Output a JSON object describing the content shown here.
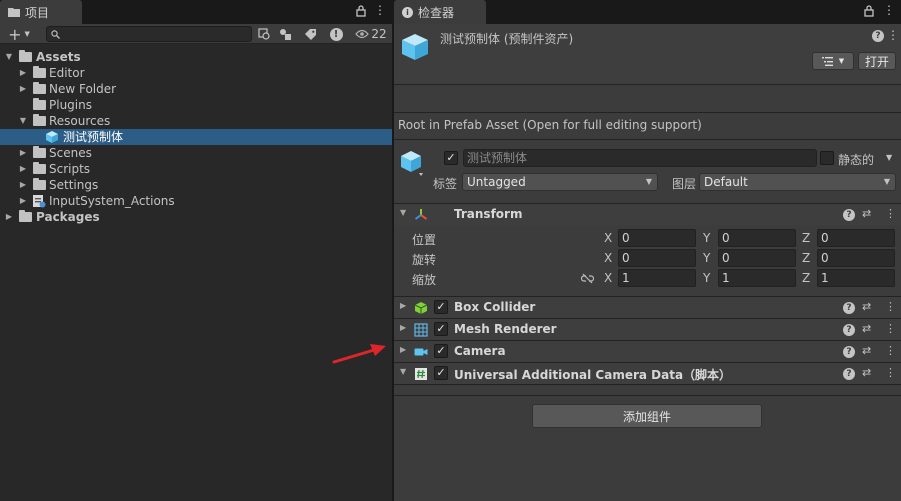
{
  "project_panel": {
    "tab_label": "项目",
    "hidden_count": "22",
    "search": {
      "value": "",
      "placeholder": ""
    },
    "tree": [
      {
        "label": "Assets",
        "bold": true
      },
      {
        "label": "Editor"
      },
      {
        "label": "New Folder"
      },
      {
        "label": "Plugins"
      },
      {
        "label": "Resources"
      },
      {
        "label": "测试预制体",
        "selected": true
      },
      {
        "label": "Scenes"
      },
      {
        "label": "Scripts"
      },
      {
        "label": "Settings"
      },
      {
        "label": "InputSystem_Actions"
      },
      {
        "label": "Packages",
        "bold": true
      }
    ]
  },
  "inspector": {
    "tab_label": "检查器",
    "asset_title": "测试预制体 (预制件资产)",
    "open_button": "打开",
    "info_text": "Root in Prefab Asset (Open for full editing support)",
    "object_name": "测试预制体",
    "static_label": "静态的",
    "tag_label": "标签",
    "tag_value": "Untagged",
    "layer_label": "图层",
    "layer_value": "Default",
    "transform": {
      "name": "Transform",
      "rows": [
        {
          "label": "位置",
          "x": "0",
          "y": "0",
          "z": "0"
        },
        {
          "label": "旋转",
          "x": "0",
          "y": "0",
          "z": "0"
        },
        {
          "label": "缩放",
          "x": "1",
          "y": "1",
          "z": "1"
        }
      ],
      "axis_x": "X",
      "axis_y": "Y",
      "axis_z": "Z"
    },
    "components": [
      {
        "name": "Box Collider",
        "icon": "box-collider-icon"
      },
      {
        "name": "Mesh Renderer",
        "icon": "mesh-renderer-icon"
      },
      {
        "name": "Camera",
        "icon": "camera-icon"
      },
      {
        "name": "Universal Additional Camera Data（脚本）",
        "icon": "script-icon"
      }
    ],
    "add_component_button": "添加组件"
  },
  "colors": {
    "selection": "#2c5d87",
    "annotation_arrow": "#e0252a",
    "prefab_cube": "#5fc3f0"
  }
}
